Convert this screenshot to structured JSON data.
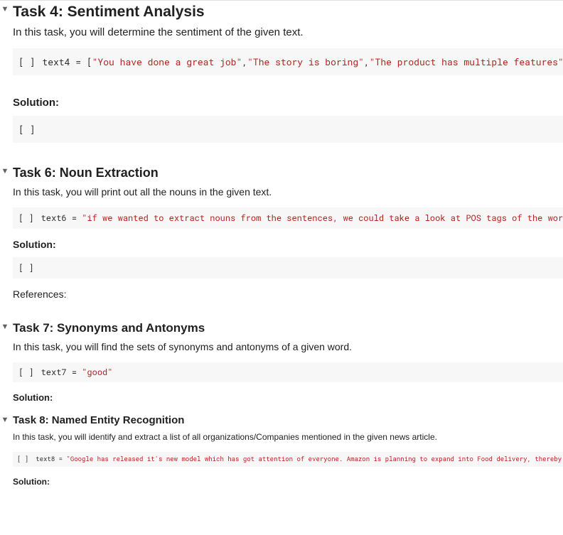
{
  "sections": [
    {
      "title": "Task 4: Sentiment Analysis",
      "desc": "In this task, you will determine the sentiment of the given text.",
      "code_var": "text4",
      "code_op": " = ",
      "code_open": "[",
      "code_strings": [
        "\"You have done a great job\"",
        "\"The story is boring\"",
        "\"The product has multiple features\""
      ],
      "code_sep": ",",
      "code_close": "]",
      "solution_label": "Solution:",
      "empty_prompt": "[ ]"
    },
    {
      "title": "Task 6: Noun Extraction",
      "desc": "In this task, you will print out all the nouns in the given text.",
      "code_var": "text6",
      "code_op": " = ",
      "code_str": "\"if we wanted to extract nouns from the sentences, we could take a look at POS tags of the words/tokens in the sentence.\"",
      "solution_label": "Solution:",
      "references_label": "References:",
      "empty_prompt": "[ ]"
    },
    {
      "title": "Task 7: Synonyms and Antonyms",
      "desc": "In this task, you will find the sets of synonyms and antonyms of a given word.",
      "code_var": "text7",
      "code_op": " = ",
      "code_str": "\"good\"",
      "solution_label": "Solution:",
      "empty_prompt": "[ ]"
    },
    {
      "title": "Task 8: Named Entity Recognition",
      "desc": "In this task, you will identify and extract a list of all organizations/Companies mentioned in the given news article.",
      "code_var": "text8",
      "code_op": " = ",
      "code_str": "\"Google has released it's new model which has got attention of everyone. Amazon is planning to expand into Food delivery, thereby giving competition . Apple is coming up with new iphone model.\"",
      "solution_label": "Solution:",
      "empty_prompt": "[ ]"
    }
  ],
  "toggle_glyph": "▼"
}
